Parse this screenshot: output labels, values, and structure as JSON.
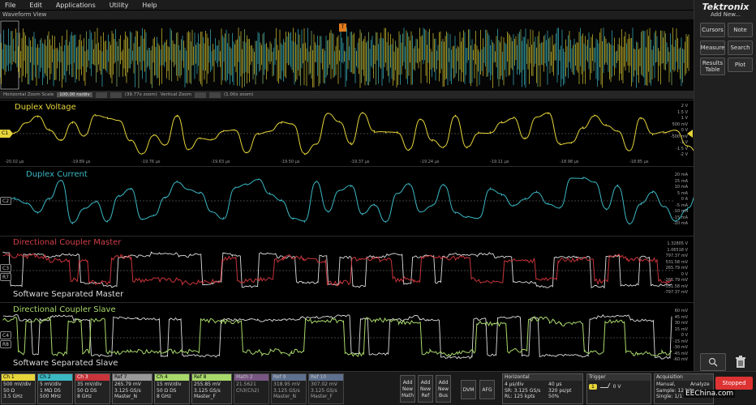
{
  "menu": [
    "File",
    "Edit",
    "Applications",
    "Utility",
    "Help"
  ],
  "sidebar": {
    "brand": "Tektronix",
    "add_new": "Add New...",
    "buttons": [
      {
        "label": "Cursors"
      },
      {
        "label": "Note"
      },
      {
        "label": "Measure"
      },
      {
        "label": "Search"
      },
      {
        "label": "Results Table"
      },
      {
        "label": "Plot"
      }
    ]
  },
  "waveform_view_title": "Waveform View",
  "zoom_bar": {
    "hscale_label": "Horizontal Zoom Scale",
    "hscale_value": "100.00 ns/div",
    "hzoom": "(39.77x zoom)",
    "vscale_label": "Vertical Zoom",
    "vzoom": "(1.00x zoom)"
  },
  "trigger_marker": "T",
  "colors": {
    "ch1": "#e6d43a",
    "ch2": "#3ab8c4",
    "ch3_ref": "#c8343a",
    "ch4": "#a8d86a",
    "sep": "#dddddd",
    "math": "#a070b0",
    "ref": "#7b95c0"
  },
  "panels": {
    "p1": {
      "title": "Duplex Voltage",
      "badge": "C1",
      "scale": [
        "2 V",
        "1.5 V",
        "1 V",
        "500 mV",
        "0 V",
        "-500 mV",
        "-1 V",
        "-1.5 V",
        "-2 V"
      ],
      "time_ticks": [
        "-20.02 µs",
        "-19.89 µs",
        "-19.76 µs",
        "-19.63 µs",
        "-19.50 µs",
        "-19.37 µs",
        "-19.24 µs",
        "-19.11 µs",
        "-18.98 µs",
        "-18.85 µs"
      ]
    },
    "p2": {
      "title": "Duplex Current",
      "badge": "C2",
      "scale": [
        "20 mA",
        "15 mA",
        "10 mA",
        "5 mA",
        "0 A",
        "-5 mA",
        "-10 mA",
        "-15 mA",
        "-20 mA"
      ]
    },
    "p3": {
      "title": "Directional Coupler Master",
      "subtitle": "Software Separated Master",
      "badges": [
        "C3",
        "R7"
      ],
      "scale": [
        "1.32805 V",
        "1.06518 V",
        "797.37 mV",
        "531.58 mV",
        "265.79 mV",
        "0 V",
        "-265.79 mV",
        "-531.58 mV",
        "-797.37 mV"
      ]
    },
    "p4": {
      "title": "Directional Coupler Slave",
      "subtitle": "Software Separated Slave",
      "badges": [
        "C4",
        "R8"
      ],
      "scale": [
        "60 mV",
        "45 mV",
        "30 mV",
        "15 mV",
        "0 V",
        "-15 mV",
        "-30 mV",
        "-45 mV",
        "-60 mV"
      ]
    }
  },
  "bottom": {
    "channels": [
      {
        "hd": "Ch 1",
        "l1": "500 mV/div",
        "l2": "50 Ω",
        "l3": "3.5 GHz"
      },
      {
        "hd": "Ch 2",
        "l1": "5 mV/div",
        "l2": "1 MΩ",
        "l2b": "DS",
        "l3": "500 MHz"
      },
      {
        "hd": "Ch 3",
        "l1": "35 mV/div",
        "l2": "50 Ω",
        "l2b": "DS",
        "l3": "8 GHz"
      },
      {
        "hd": "Ref 7",
        "l1": "265.79 mV",
        "l2": "3.125 GS/s",
        "l3": "Master_N"
      },
      {
        "hd": "Ch 4",
        "l1": "15 mV/div",
        "l2": "50 Ω",
        "l2b": "DS",
        "l3": "8 GHz"
      },
      {
        "hd": "Ref 8",
        "l1": "255.85 mV",
        "l2": "3.125 GS/s",
        "l3": "Master_F"
      },
      {
        "hd": "Math 2",
        "l1": "21.5621",
        "l2": "Ch3(Ch2)",
        "l3": ""
      },
      {
        "hd": "Ref 9",
        "l1": "318.95 mV",
        "l2": "3.125 GS/s",
        "l3": "Master_N"
      },
      {
        "hd": "Ref 10",
        "l1": "307.02 mV",
        "l2": "3.125 GS/s",
        "l3": "Master_F"
      }
    ],
    "add_buttons": [
      "Add New Math",
      "Add New Ref",
      "Add New Bus"
    ],
    "dvm": "DVM",
    "afg": "AFG",
    "horizontal": {
      "hd": "Horizontal",
      "l1": "4 µs/div",
      "l1b": "40 µs",
      "l2": "SR: 3.125 GS/s",
      "l2b": "320 ps/pt",
      "l3": "RL: 125 kpts",
      "l3b": "50%"
    },
    "trigger": {
      "hd": "Trigger",
      "badge": "1",
      "value": "0 V"
    },
    "acquisition": {
      "hd": "Acquisition",
      "l1": "Manual,",
      "l1b": "Analyze",
      "l2": "Sample: 12 bits",
      "l3": "Single: 1/1"
    },
    "stopped": "Stopped"
  },
  "watermark": "EEChina.com"
}
